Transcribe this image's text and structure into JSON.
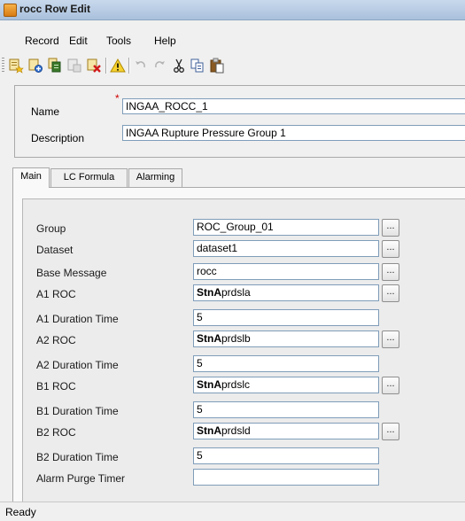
{
  "window": {
    "title": "rocc Row Edit"
  },
  "menu": [
    "Record",
    "Edit",
    "Tools",
    "Help"
  ],
  "toolbar": {
    "icons": [
      "new-record-icon",
      "add-record-icon",
      "copy-record-icon",
      "paste-record-icon",
      "delete-record-icon",
      "warning-icon",
      "undo-icon",
      "redo-icon",
      "cut-icon",
      "copy-icon",
      "paste-icon"
    ]
  },
  "header": {
    "name_label": "Name",
    "name_required_mark": "*",
    "name_value": "INGAA_ROCC_1",
    "description_label": "Description",
    "description_value": "INGAA Rupture Pressure Group 1"
  },
  "tabs": [
    "Main",
    "LC Formula",
    "Alarming"
  ],
  "active_tab": "Main",
  "main": {
    "rows": [
      {
        "label": "Group",
        "value": "ROC_Group_01",
        "bold": "",
        "has_button": true,
        "button_label": "..."
      },
      {
        "label": "Dataset",
        "value": "dataset1",
        "bold": "",
        "has_button": true,
        "button_label": "..."
      },
      {
        "label": "Base Message",
        "value": "rocc",
        "bold": "",
        "has_button": true,
        "button_label": "..."
      },
      {
        "label": "A1 ROC",
        "value": "prdsla",
        "bold": "StnA",
        "has_button": true,
        "button_label": "..."
      },
      {
        "label": "A1 Duration Time",
        "value": "5",
        "bold": "",
        "has_button": false
      },
      {
        "label": "A2 ROC",
        "value": "prdslb",
        "bold": "StnA",
        "has_button": true,
        "button_label": "..."
      },
      {
        "label": "A2 Duration Time",
        "value": "5",
        "bold": "",
        "has_button": false
      },
      {
        "label": "B1 ROC",
        "value": "prdslc",
        "bold": "StnA",
        "has_button": true,
        "button_label": "..."
      },
      {
        "label": "B1 Duration Time",
        "value": "5",
        "bold": "",
        "has_button": false
      },
      {
        "label": "B2 ROC",
        "value": "prdsld",
        "bold": "StnA",
        "has_button": true,
        "button_label": "..."
      },
      {
        "label": "B2 Duration Time",
        "value": "5",
        "bold": "",
        "has_button": false
      },
      {
        "label": "Alarm Purge Timer",
        "value": "",
        "bold": "",
        "has_button": false
      }
    ]
  },
  "status": {
    "text": "Ready"
  }
}
